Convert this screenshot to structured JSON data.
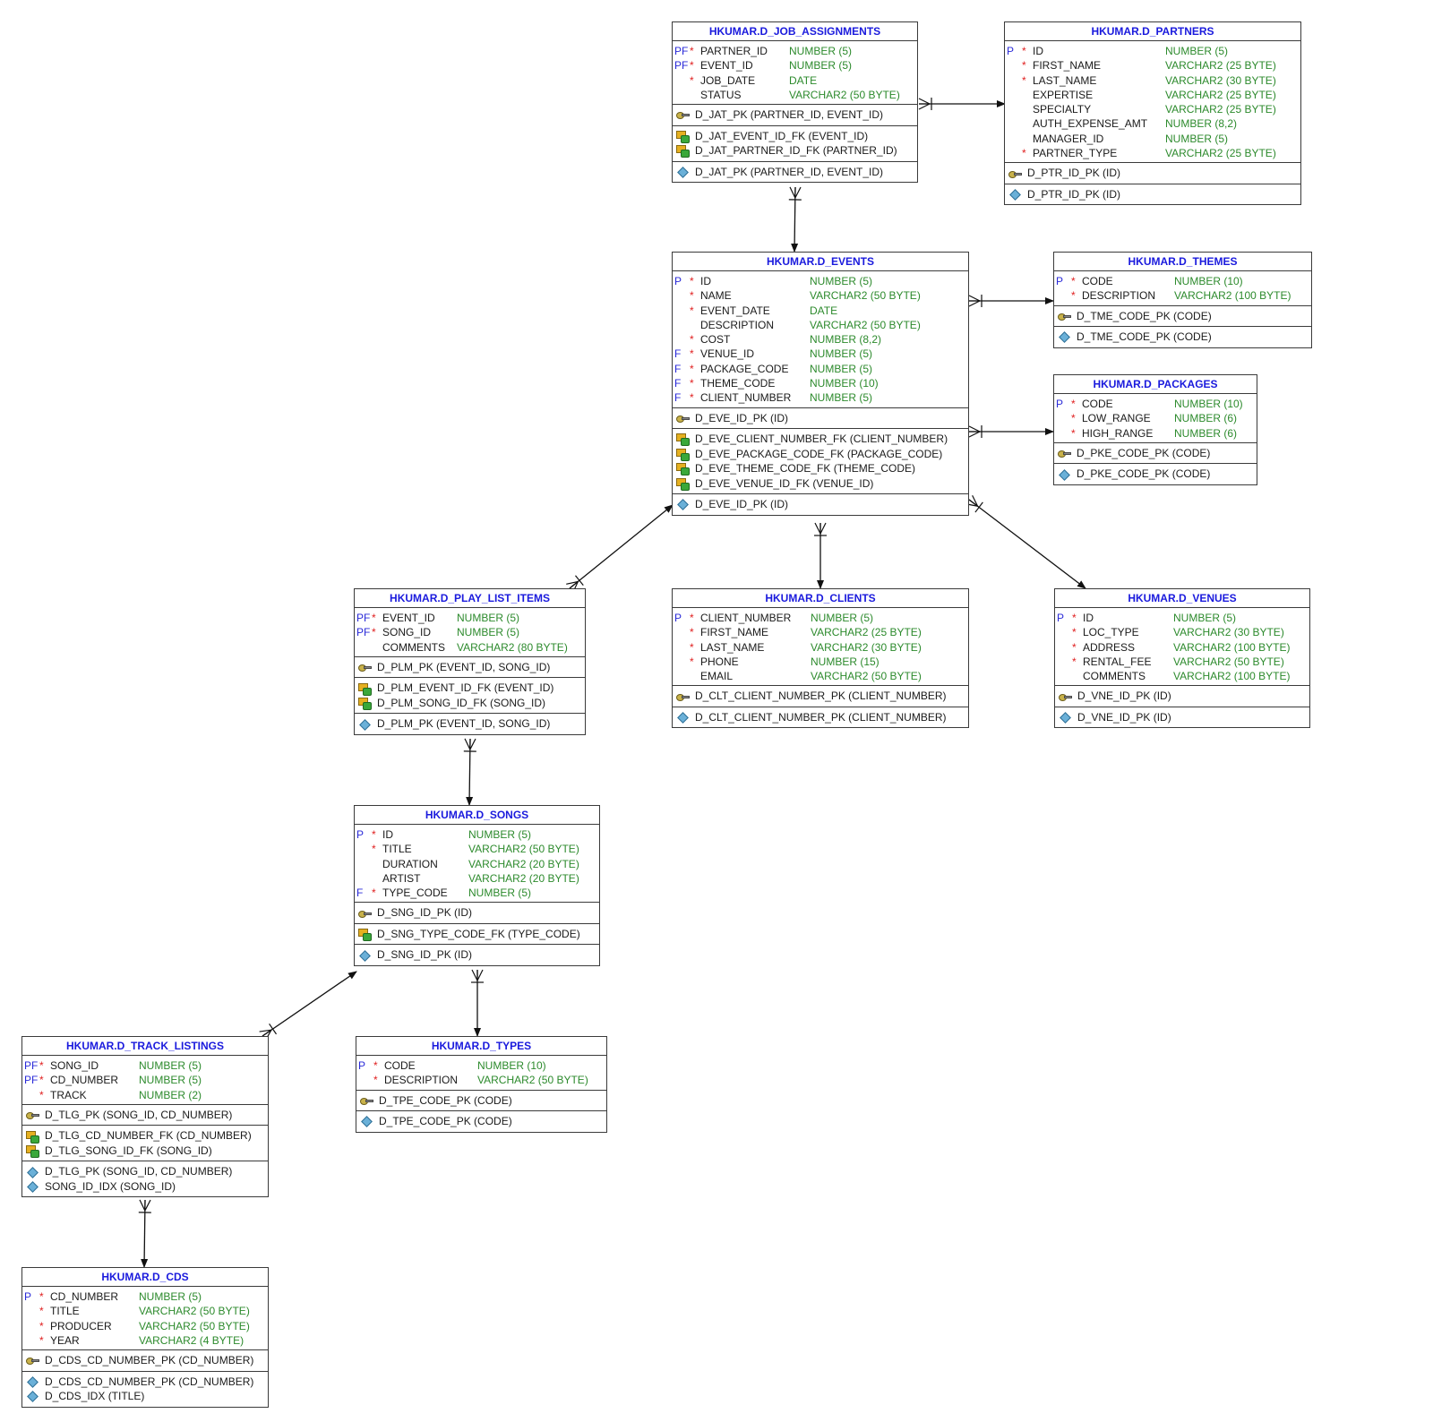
{
  "colors": {
    "title": "#1a1add",
    "key_flag": "#2a2ad8",
    "required_mark": "#e02020",
    "datatype": "#2c8a2c",
    "border": "#3a3a3a",
    "relationship_line": "#111111"
  },
  "icons": {
    "pk_constraint": "key-icon",
    "fk_constraint": "foreign-key-icon",
    "index": "index-diamond-icon"
  },
  "tables": [
    {
      "id": "job_assignments",
      "title": "HKUMAR.D_JOB_ASSIGNMENTS",
      "columns": [
        {
          "key": "PF",
          "req": "*",
          "name": "PARTNER_ID",
          "type": "NUMBER (5)"
        },
        {
          "key": "PF",
          "req": "*",
          "name": "EVENT_ID",
          "type": "NUMBER (5)"
        },
        {
          "key": "",
          "req": "*",
          "name": "JOB_DATE",
          "type": "DATE"
        },
        {
          "key": "",
          "req": "",
          "name": "STATUS",
          "type": "VARCHAR2 (50 BYTE)"
        }
      ],
      "pk": [
        "D_JAT_PK (PARTNER_ID, EVENT_ID)"
      ],
      "fk": [
        "D_JAT_EVENT_ID_FK (EVENT_ID)",
        "D_JAT_PARTNER_ID_FK (PARTNER_ID)"
      ],
      "idx": [
        "D_JAT_PK (PARTNER_ID, EVENT_ID)"
      ]
    },
    {
      "id": "partners",
      "title": "HKUMAR.D_PARTNERS",
      "columns": [
        {
          "key": "P",
          "req": "*",
          "name": "ID",
          "type": "NUMBER (5)"
        },
        {
          "key": "",
          "req": "*",
          "name": "FIRST_NAME",
          "type": "VARCHAR2 (25 BYTE)"
        },
        {
          "key": "",
          "req": "*",
          "name": "LAST_NAME",
          "type": "VARCHAR2 (30 BYTE)"
        },
        {
          "key": "",
          "req": "",
          "name": "EXPERTISE",
          "type": "VARCHAR2 (25 BYTE)"
        },
        {
          "key": "",
          "req": "",
          "name": "SPECIALTY",
          "type": "VARCHAR2 (25 BYTE)"
        },
        {
          "key": "",
          "req": "",
          "name": "AUTH_EXPENSE_AMT",
          "type": "NUMBER (8,2)"
        },
        {
          "key": "",
          "req": "",
          "name": "MANAGER_ID",
          "type": "NUMBER (5)"
        },
        {
          "key": "",
          "req": "*",
          "name": "PARTNER_TYPE",
          "type": "VARCHAR2 (25 BYTE)"
        }
      ],
      "pk": [
        "D_PTR_ID_PK (ID)"
      ],
      "fk": [],
      "idx": [
        "D_PTR_ID_PK (ID)"
      ]
    },
    {
      "id": "events",
      "title": "HKUMAR.D_EVENTS",
      "columns": [
        {
          "key": "P",
          "req": "*",
          "name": "ID",
          "type": "NUMBER (5)"
        },
        {
          "key": "",
          "req": "*",
          "name": "NAME",
          "type": "VARCHAR2 (50 BYTE)"
        },
        {
          "key": "",
          "req": "*",
          "name": "EVENT_DATE",
          "type": "DATE"
        },
        {
          "key": "",
          "req": "",
          "name": "DESCRIPTION",
          "type": "VARCHAR2 (50 BYTE)"
        },
        {
          "key": "",
          "req": "*",
          "name": "COST",
          "type": "NUMBER (8,2)"
        },
        {
          "key": "F",
          "req": "*",
          "name": "VENUE_ID",
          "type": "NUMBER (5)"
        },
        {
          "key": "F",
          "req": "*",
          "name": "PACKAGE_CODE",
          "type": "NUMBER (5)"
        },
        {
          "key": "F",
          "req": "*",
          "name": "THEME_CODE",
          "type": "NUMBER (10)"
        },
        {
          "key": "F",
          "req": "*",
          "name": "CLIENT_NUMBER",
          "type": "NUMBER (5)"
        }
      ],
      "pk": [
        "D_EVE_ID_PK (ID)"
      ],
      "fk": [
        "D_EVE_CLIENT_NUMBER_FK (CLIENT_NUMBER)",
        "D_EVE_PACKAGE_CODE_FK (PACKAGE_CODE)",
        "D_EVE_THEME_CODE_FK (THEME_CODE)",
        "D_EVE_VENUE_ID_FK (VENUE_ID)"
      ],
      "idx": [
        "D_EVE_ID_PK (ID)"
      ]
    },
    {
      "id": "themes",
      "title": "HKUMAR.D_THEMES",
      "columns": [
        {
          "key": "P",
          "req": "*",
          "name": "CODE",
          "type": "NUMBER (10)"
        },
        {
          "key": "",
          "req": "*",
          "name": "DESCRIPTION",
          "type": "VARCHAR2 (100 BYTE)"
        }
      ],
      "pk": [
        "D_TME_CODE_PK (CODE)"
      ],
      "fk": [],
      "idx": [
        "D_TME_CODE_PK (CODE)"
      ]
    },
    {
      "id": "packages",
      "title": "HKUMAR.D_PACKAGES",
      "columns": [
        {
          "key": "P",
          "req": "*",
          "name": "CODE",
          "type": "NUMBER (10)"
        },
        {
          "key": "",
          "req": "*",
          "name": "LOW_RANGE",
          "type": "NUMBER (6)"
        },
        {
          "key": "",
          "req": "*",
          "name": "HIGH_RANGE",
          "type": "NUMBER (6)"
        }
      ],
      "pk": [
        "D_PKE_CODE_PK (CODE)"
      ],
      "fk": [],
      "idx": [
        "D_PKE_CODE_PK (CODE)"
      ]
    },
    {
      "id": "play_list_items",
      "title": "HKUMAR.D_PLAY_LIST_ITEMS",
      "columns": [
        {
          "key": "PF",
          "req": "*",
          "name": "EVENT_ID",
          "type": "NUMBER (5)"
        },
        {
          "key": "PF",
          "req": "*",
          "name": "SONG_ID",
          "type": "NUMBER (5)"
        },
        {
          "key": "",
          "req": "",
          "name": "COMMENTS",
          "type": "VARCHAR2 (80 BYTE)"
        }
      ],
      "pk": [
        "D_PLM_PK (EVENT_ID, SONG_ID)"
      ],
      "fk": [
        "D_PLM_EVENT_ID_FK (EVENT_ID)",
        "D_PLM_SONG_ID_FK (SONG_ID)"
      ],
      "idx": [
        "D_PLM_PK (EVENT_ID, SONG_ID)"
      ]
    },
    {
      "id": "clients",
      "title": "HKUMAR.D_CLIENTS",
      "columns": [
        {
          "key": "P",
          "req": "*",
          "name": "CLIENT_NUMBER",
          "type": "NUMBER (5)"
        },
        {
          "key": "",
          "req": "*",
          "name": "FIRST_NAME",
          "type": "VARCHAR2 (25 BYTE)"
        },
        {
          "key": "",
          "req": "*",
          "name": "LAST_NAME",
          "type": "VARCHAR2 (30 BYTE)"
        },
        {
          "key": "",
          "req": "*",
          "name": "PHONE",
          "type": "NUMBER (15)"
        },
        {
          "key": "",
          "req": "",
          "name": "EMAIL",
          "type": "VARCHAR2 (50 BYTE)"
        }
      ],
      "pk": [
        "D_CLT_CLIENT_NUMBER_PK (CLIENT_NUMBER)"
      ],
      "fk": [],
      "idx": [
        "D_CLT_CLIENT_NUMBER_PK (CLIENT_NUMBER)"
      ]
    },
    {
      "id": "venues",
      "title": "HKUMAR.D_VENUES",
      "columns": [
        {
          "key": "P",
          "req": "*",
          "name": "ID",
          "type": "NUMBER (5)"
        },
        {
          "key": "",
          "req": "*",
          "name": "LOC_TYPE",
          "type": "VARCHAR2 (30 BYTE)"
        },
        {
          "key": "",
          "req": "*",
          "name": "ADDRESS",
          "type": "VARCHAR2 (100 BYTE)"
        },
        {
          "key": "",
          "req": "*",
          "name": "RENTAL_FEE",
          "type": "VARCHAR2 (50 BYTE)"
        },
        {
          "key": "",
          "req": "",
          "name": "COMMENTS",
          "type": "VARCHAR2 (100 BYTE)"
        }
      ],
      "pk": [
        "D_VNE_ID_PK (ID)"
      ],
      "fk": [],
      "idx": [
        "D_VNE_ID_PK (ID)"
      ]
    },
    {
      "id": "songs",
      "title": "HKUMAR.D_SONGS",
      "columns": [
        {
          "key": "P",
          "req": "*",
          "name": "ID",
          "type": "NUMBER (5)"
        },
        {
          "key": "",
          "req": "*",
          "name": "TITLE",
          "type": "VARCHAR2 (50 BYTE)"
        },
        {
          "key": "",
          "req": "",
          "name": "DURATION",
          "type": "VARCHAR2 (20 BYTE)"
        },
        {
          "key": "",
          "req": "",
          "name": "ARTIST",
          "type": "VARCHAR2 (20 BYTE)"
        },
        {
          "key": "F",
          "req": "*",
          "name": "TYPE_CODE",
          "type": "NUMBER (5)"
        }
      ],
      "pk": [
        "D_SNG_ID_PK (ID)"
      ],
      "fk": [
        "D_SNG_TYPE_CODE_FK (TYPE_CODE)"
      ],
      "idx": [
        "D_SNG_ID_PK (ID)"
      ]
    },
    {
      "id": "track_listings",
      "title": "HKUMAR.D_TRACK_LISTINGS",
      "columns": [
        {
          "key": "PF",
          "req": "*",
          "name": "SONG_ID",
          "type": "NUMBER (5)"
        },
        {
          "key": "PF",
          "req": "*",
          "name": "CD_NUMBER",
          "type": "NUMBER (5)"
        },
        {
          "key": "",
          "req": "*",
          "name": "TRACK",
          "type": "NUMBER (2)"
        }
      ],
      "pk": [
        "D_TLG_PK (SONG_ID, CD_NUMBER)"
      ],
      "fk": [
        "D_TLG_CD_NUMBER_FK (CD_NUMBER)",
        "D_TLG_SONG_ID_FK (SONG_ID)"
      ],
      "idx": [
        "D_TLG_PK (SONG_ID, CD_NUMBER)",
        "SONG_ID_IDX (SONG_ID)"
      ]
    },
    {
      "id": "types",
      "title": "HKUMAR.D_TYPES",
      "columns": [
        {
          "key": "P",
          "req": "*",
          "name": "CODE",
          "type": "NUMBER (10)"
        },
        {
          "key": "",
          "req": "*",
          "name": "DESCRIPTION",
          "type": "VARCHAR2 (50 BYTE)"
        }
      ],
      "pk": [
        "D_TPE_CODE_PK (CODE)"
      ],
      "fk": [],
      "idx": [
        "D_TPE_CODE_PK (CODE)"
      ]
    },
    {
      "id": "cds",
      "title": "HKUMAR.D_CDS",
      "columns": [
        {
          "key": "P",
          "req": "*",
          "name": "CD_NUMBER",
          "type": "NUMBER (5)"
        },
        {
          "key": "",
          "req": "*",
          "name": "TITLE",
          "type": "VARCHAR2 (50 BYTE)"
        },
        {
          "key": "",
          "req": "*",
          "name": "PRODUCER",
          "type": "VARCHAR2 (50 BYTE)"
        },
        {
          "key": "",
          "req": "*",
          "name": "YEAR",
          "type": "VARCHAR2 (4 BYTE)"
        }
      ],
      "pk": [
        "D_CDS_CD_NUMBER_PK (CD_NUMBER)"
      ],
      "fk": [],
      "idx": [
        "D_CDS_CD_NUMBER_PK (CD_NUMBER)",
        "D_CDS_IDX (TITLE)"
      ]
    }
  ],
  "relationships": [
    {
      "from": "job_assignments",
      "to": "partners"
    },
    {
      "from": "job_assignments",
      "to": "events"
    },
    {
      "from": "events",
      "to": "themes"
    },
    {
      "from": "events",
      "to": "packages"
    },
    {
      "from": "events",
      "to": "clients"
    },
    {
      "from": "events",
      "to": "venues"
    },
    {
      "from": "play_list_items",
      "to": "events"
    },
    {
      "from": "play_list_items",
      "to": "songs"
    },
    {
      "from": "songs",
      "to": "types"
    },
    {
      "from": "track_listings",
      "to": "songs"
    },
    {
      "from": "track_listings",
      "to": "cds"
    }
  ]
}
